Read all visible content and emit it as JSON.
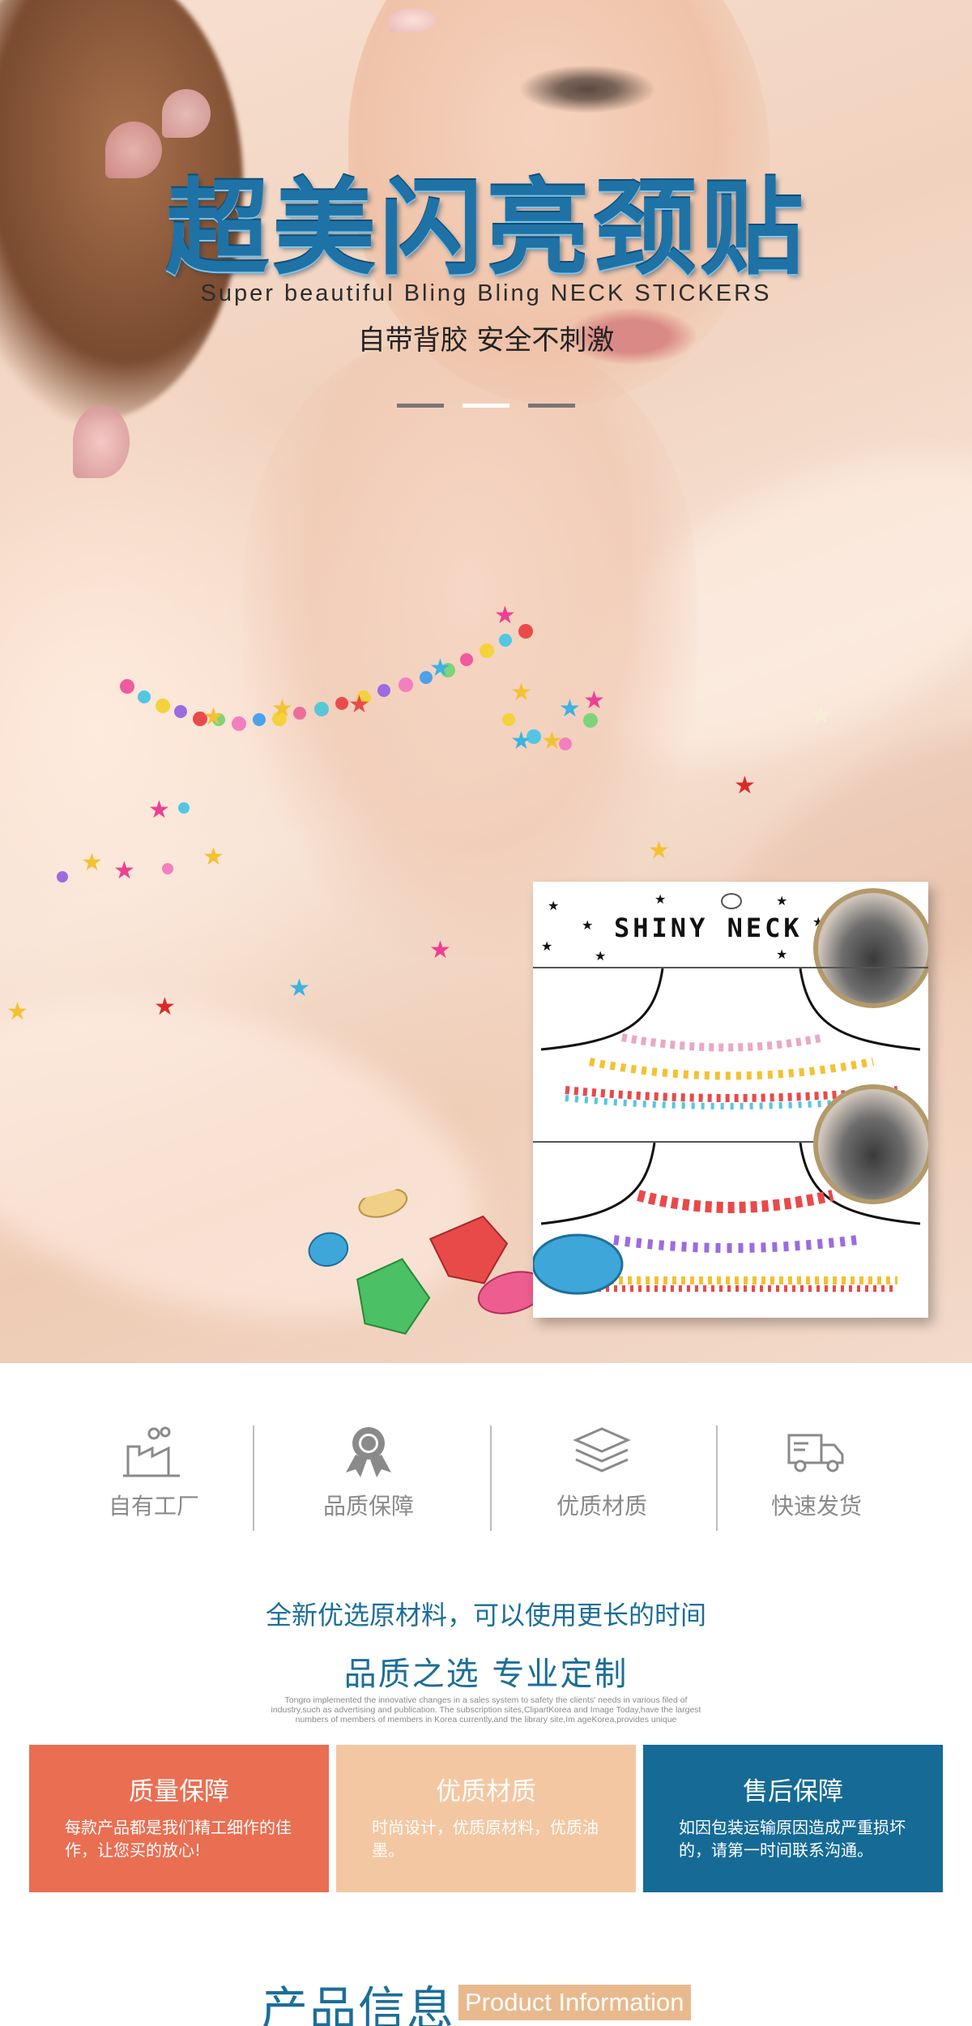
{
  "hero": {
    "title": "超美闪亮颈贴",
    "subtitle_en": "Super beautiful Bling Bling NECK STICKERS",
    "subtitle_cn": "自带背胶   安全不刺激",
    "product_card": {
      "brand": "SHINY NECK"
    },
    "colors": {
      "title": "#1f72a6",
      "dash_dark": "#7d7475",
      "dash_light": "#ffffff"
    }
  },
  "features": [
    {
      "label": "自有工厂",
      "icon": "factory-icon"
    },
    {
      "label": "品质保障",
      "icon": "award-badge-icon"
    },
    {
      "label": "优质材质",
      "icon": "layers-icon"
    },
    {
      "label": "快速发货",
      "icon": "truck-icon"
    }
  ],
  "tagline": {
    "line1": "全新优选原材料，可以使用更长的时间",
    "line2": "品质之选    专业定制",
    "smallprint": "Tongro implemented the innovative changes in a sales system to safety the clients' needs in various filed of industry,such as advertising and publication. The subscription sites,ClipartKorea and Image Today,have the largest numbers of members  of members in Korea currently,and the library site,Im ageKorea,provides unique"
  },
  "boxes": [
    {
      "title": "质量保障",
      "text": "每款产品都是我们精工细作的佳作，让您买的放心!",
      "color": "#ea6e52"
    },
    {
      "title": "优质材质",
      "text": "时尚设计，优质原材料，优质油墨。",
      "color": "#f3c7a2"
    },
    {
      "title": "售后保障",
      "text": "如因包装运输原因造成严重损坏的，请第一时间联系沟通。",
      "color": "#156b96"
    }
  ],
  "product_info": {
    "title_cn": "产品信息",
    "title_en": "Product Information",
    "accent": "#e9b98e"
  }
}
